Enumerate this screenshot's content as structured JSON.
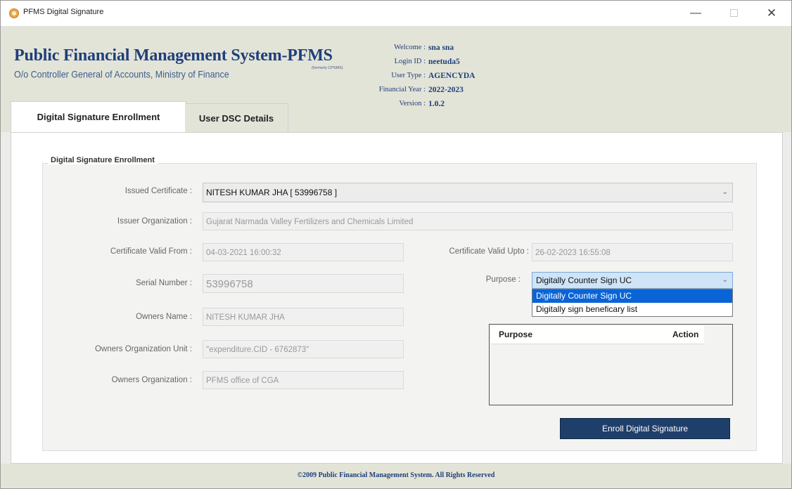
{
  "window": {
    "title": "PFMS Digital Signature",
    "min_icon": "—",
    "close_icon": "✕"
  },
  "header": {
    "title": "Public Financial Management System-PFMS",
    "formerly": "(formerly CPSMS)",
    "subtitle": "O/o Controller General of Accounts, Ministry of Finance",
    "info": [
      {
        "label": "Welcome :",
        "value": "sna sna"
      },
      {
        "label": "Login ID :",
        "value": "neetuda5"
      },
      {
        "label": "User Type :",
        "value": "AGENCYDA"
      },
      {
        "label": "Financial Year :",
        "value": "2022-2023"
      },
      {
        "label": "Version :",
        "value": "1.0.2"
      }
    ]
  },
  "tabs": [
    {
      "label": "Digital Signature Enrollment",
      "active": true
    },
    {
      "label": "User DSC Details",
      "active": false
    }
  ],
  "form": {
    "group_title": "Digital Signature Enrollment",
    "issued_certificate": {
      "label": "Issued Certificate :",
      "value": "NITESH KUMAR JHA [ 53996758 ]"
    },
    "issuer_org": {
      "label": "Issuer Organization :",
      "value": "Gujarat Narmada Valley Fertilizers and Chemicals Limited"
    },
    "valid_from": {
      "label": "Certificate Valid From :",
      "value": "04-03-2021 16:00:32"
    },
    "valid_upto": {
      "label": "Certificate Valid Upto :",
      "value": "26-02-2023 16:55:08"
    },
    "serial_number": {
      "label": "Serial Number :",
      "value": "53996758"
    },
    "purpose": {
      "label": "Purpose :",
      "value": "Digitally Counter Sign UC",
      "options": [
        "Digitally Counter Sign UC",
        "Digitally sign beneficary list"
      ]
    },
    "owners_name": {
      "label": "Owners Name :",
      "value": "NITESH KUMAR JHA"
    },
    "owners_org_unit": {
      "label": "Owners Organization Unit :",
      "value": "\"expenditure.CID - 6762873\""
    },
    "owners_org": {
      "label": "Owners Organization :",
      "value": "PFMS office of CGA"
    },
    "table_headers": {
      "purpose": "Purpose",
      "action": "Action"
    },
    "enroll_button": "Enroll Digital Signature"
  },
  "footer": {
    "text": "©2009 Public Financial Management System. All Rights Reserved"
  },
  "colors": {
    "brand": "#1f3f7a",
    "header_bg": "#e3e4d8",
    "button_bg": "#1f3f6b",
    "selection": "#0a64d6"
  }
}
